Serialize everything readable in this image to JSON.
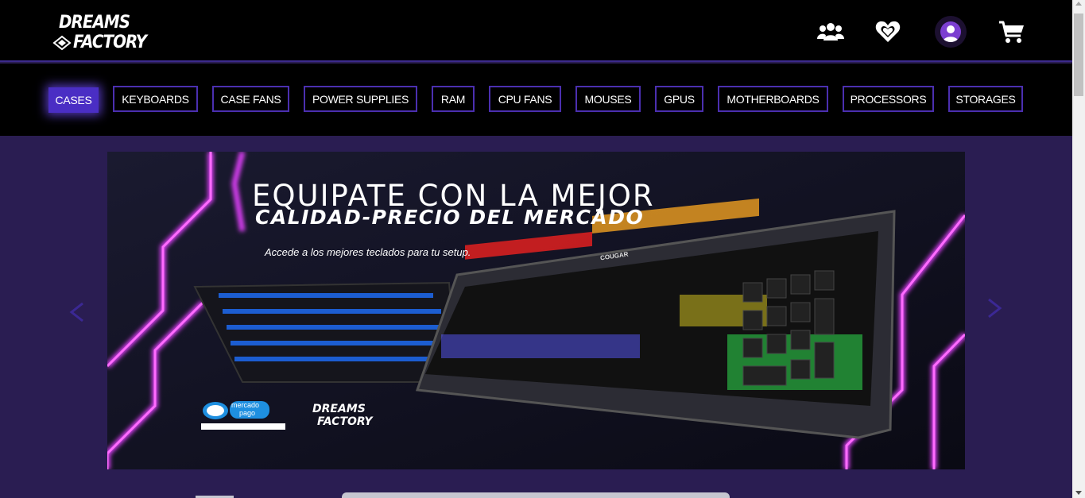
{
  "brand": {
    "line1": "DREAMS",
    "line2": "FACTORY"
  },
  "header_icons": [
    "users-icon",
    "heart-icon",
    "user-avatar-icon",
    "cart-icon"
  ],
  "categories": [
    {
      "label": "CASES",
      "active": true
    },
    {
      "label": "KEYBOARDS",
      "active": false
    },
    {
      "label": "CASE FANS",
      "active": false
    },
    {
      "label": "POWER SUPPLIES",
      "active": false
    },
    {
      "label": "RAM",
      "active": false
    },
    {
      "label": "CPU FANS",
      "active": false
    },
    {
      "label": "MOUSES",
      "active": false
    },
    {
      "label": "GPUS",
      "active": false
    },
    {
      "label": "MOTHERBOARDS",
      "active": false
    },
    {
      "label": "PROCESSORS",
      "active": false
    },
    {
      "label": "STORAGES",
      "active": false
    }
  ],
  "banner": {
    "headline": "EQUIPATE CON LA MEJOR",
    "subheadline": "CALIDAD-PRECIO DEL MERCADO",
    "tagline": "Accede a los mejores teclados para tu setup.",
    "payment_logo": {
      "line1": "mercado",
      "line2": "pago"
    },
    "brand_line1": "DREAMS",
    "brand_line2": "FACTORY",
    "keyboard_brand": "COUGAR"
  },
  "carousel": {
    "prev_icon": "chevron-left-icon",
    "next_icon": "chevron-right-icon"
  },
  "colors": {
    "accent": "#4a2ec4",
    "nav_border": "#4b2fb0",
    "page_bg": "#2a1d52",
    "neon_pink": "#e040fb"
  }
}
